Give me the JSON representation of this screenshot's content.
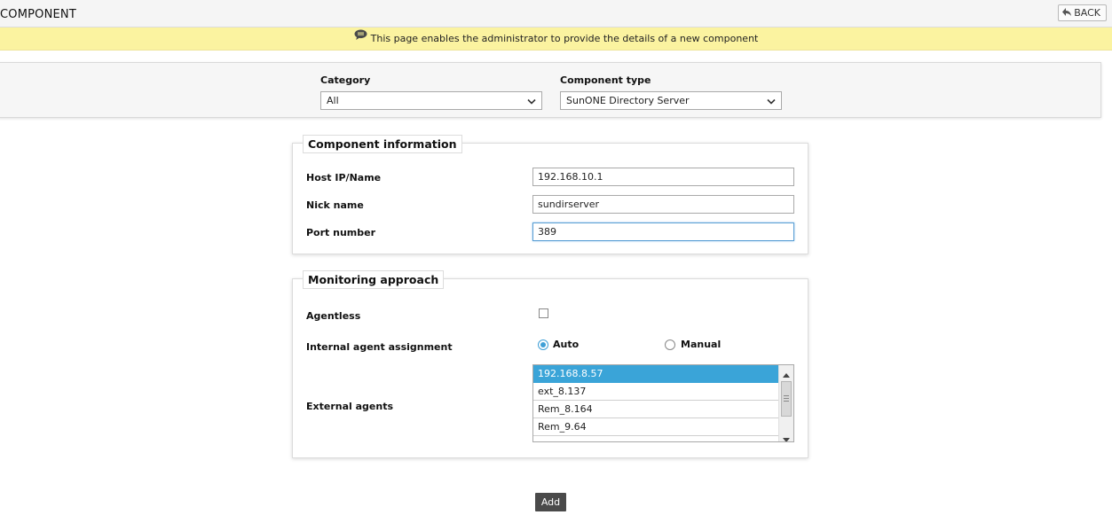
{
  "header": {
    "title": "COMPONENT",
    "back_label": "BACK"
  },
  "notice": {
    "text": "This page enables the administrator to provide the details of a new component",
    "icon": "chat-bubble-icon"
  },
  "filters": {
    "category_label": "Category",
    "category_value": "All",
    "component_type_label": "Component type",
    "component_type_value": "SunONE Directory Server"
  },
  "component_info": {
    "legend": "Component information",
    "host_label": "Host IP/Name",
    "host_value": "192.168.10.1",
    "nick_label": "Nick name",
    "nick_value": "sundirserver",
    "port_label": "Port number",
    "port_value": "389"
  },
  "monitoring": {
    "legend": "Monitoring approach",
    "agentless_label": "Agentless",
    "agentless_checked": false,
    "internal_agent_label": "Internal agent assignment",
    "option_auto": "Auto",
    "option_manual": "Manual",
    "selected_option": "Auto",
    "external_agents_label": "External agents",
    "external_agents": [
      "192.168.8.57",
      "ext_8.137",
      "Rem_8.164",
      "Rem_9.64"
    ],
    "selected_agent": "192.168.8.57"
  },
  "actions": {
    "add_label": "Add"
  },
  "colors": {
    "notice_bg": "#fbf3a0",
    "accent": "#3aa4d8",
    "add_button_bg": "#4a4a4a"
  }
}
